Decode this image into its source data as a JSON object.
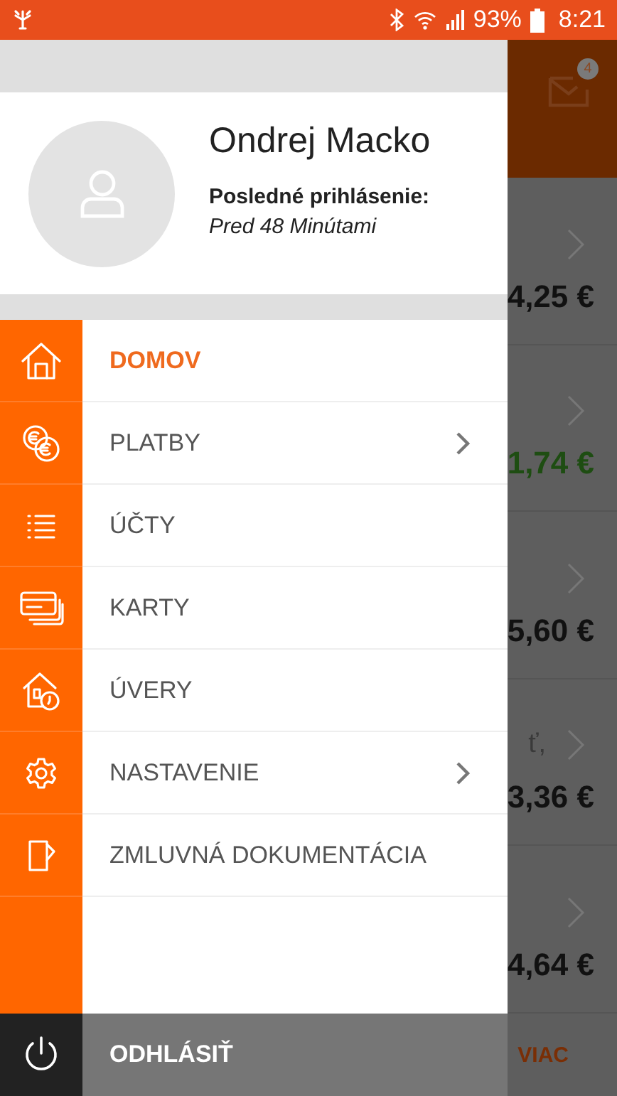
{
  "status_bar": {
    "battery": "93%",
    "time": "8:21"
  },
  "background": {
    "mail_badge": "4",
    "rows": [
      {
        "amount": "4,25 €",
        "kind": "debit"
      },
      {
        "amount": "1,74 €",
        "kind": "credit"
      },
      {
        "amount": "5,60 €",
        "kind": "debit"
      },
      {
        "text": "ť,",
        "amount": "3,36 €",
        "kind": "debit"
      },
      {
        "amount": "4,64 €",
        "kind": "debit"
      }
    ],
    "more": "VIAC"
  },
  "drawer": {
    "user": {
      "name": "Ondrej Macko",
      "last_login_label": "Posledné prihlásenie:",
      "last_login": "Pred 48 Minútami"
    },
    "menu": [
      {
        "label": "DOMOV",
        "selected": true,
        "has_submenu": false
      },
      {
        "label": "PLATBY",
        "selected": false,
        "has_submenu": true
      },
      {
        "label": "ÚČTY",
        "selected": false,
        "has_submenu": false
      },
      {
        "label": "KARTY",
        "selected": false,
        "has_submenu": false
      },
      {
        "label": "ÚVERY",
        "selected": false,
        "has_submenu": false
      },
      {
        "label": "NASTAVENIE",
        "selected": false,
        "has_submenu": true
      },
      {
        "label": "ZMLUVNÁ DOKUMENTÁCIA",
        "selected": false,
        "has_submenu": false
      }
    ],
    "logout": "ODHLÁSIŤ"
  }
}
